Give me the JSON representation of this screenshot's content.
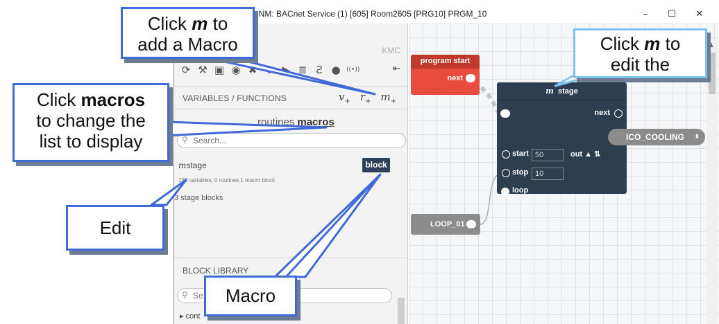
{
  "window": {
    "title": "r - NM: BACnet Service (1) [605] Room2605 [PRG10] PRGM_10",
    "minimize": "–",
    "maximize": "☐",
    "close": "✕"
  },
  "left_panel": {
    "brand": "KMC",
    "toolbar_icons": [
      "refresh-icon",
      "hammer-icon",
      "save-icon",
      "stop-icon",
      "delete-icon",
      "download-icon",
      "play-icon",
      "list-icon",
      "s-icon",
      "r-icon",
      "broadcast-icon"
    ],
    "collapse": "⇤",
    "variables_header": "VARIABLES / FUNCTIONS",
    "vrm": [
      "v",
      "r",
      "m"
    ],
    "list_prefix": "routines",
    "list_macros": "macros",
    "search_placeholder": "Search...",
    "macro_prefix": "m",
    "macro_name": "stage",
    "block_label": "block",
    "summary": "188 variables, 0 routines 1 macro block",
    "stage_blocks": "3 stage blocks",
    "block_library_header": "BLOCK LIBRARY",
    "library_search_placeholder": "Se",
    "library_tree_item": "▸ cont"
  },
  "canvas": {
    "program_start": {
      "title": "program start",
      "next": "next"
    },
    "stage_block": {
      "title_prefix": "m",
      "title": "stage",
      "next": "next",
      "start_label": "start",
      "start_value": "50",
      "stop_label": "stop",
      "stop_value": "10",
      "loop_label": "loop",
      "out_label": "out ▲ ⇅"
    },
    "output_var": {
      "name": "ICO_COOLING",
      "arrow": "⬍"
    },
    "loop_var": {
      "name": "LOOP_01"
    }
  },
  "callouts": {
    "add_macro": {
      "line1_pre": "Click ",
      "line1_em": "m",
      "line1_post": " to",
      "line2": "add a Macro"
    },
    "edit_macro": {
      "line1_pre": "Click ",
      "line1_em": "m",
      "line1_post": " to",
      "line2": "edit the"
    },
    "change_list": {
      "line1_pre": "Click ",
      "line1_em": "macros",
      "line2": "to change the",
      "line3": "list to display"
    },
    "edit": {
      "text": "Edit"
    },
    "macro": {
      "text": "Macro"
    }
  },
  "colors": {
    "callout_border": "#3f6ad8",
    "callout_border_light": "#7fc2ee",
    "block_dark": "#2c3e50",
    "program_start_red": "#e74c3c",
    "variable_gray": "#8c8c8c"
  }
}
